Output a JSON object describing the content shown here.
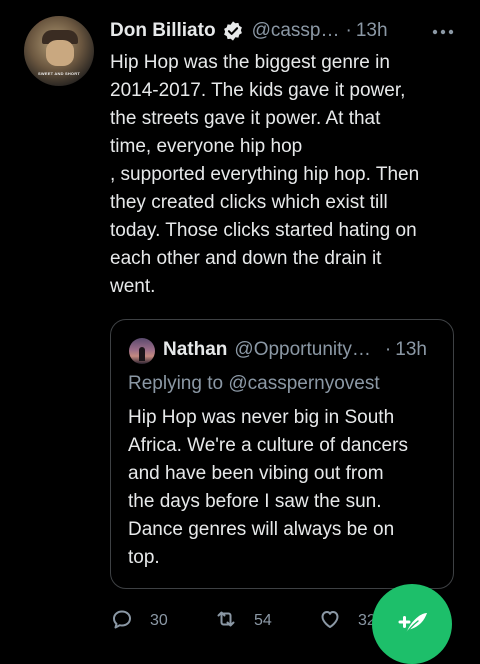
{
  "tweet": {
    "author_name": "Don Billiato",
    "handle": "@cassp…",
    "dot": "·",
    "time": "13h",
    "body_lines": [
      "Hip Hop was the biggest genre in",
      "2014-2017. The kids gave it power,",
      "the streets gave it power. At that",
      "time, everyone hip hop",
      ", supported everything hip hop. Then",
      "they created clicks which exist till",
      "today. Those clicks started hating on",
      "each other and down the drain it",
      "went."
    ],
    "avatar_text": "SWEET AND SHORT",
    "icons": {
      "verified": "verified-badge-icon",
      "more": "more-options-icon"
    }
  },
  "quote": {
    "author_name": "Nathan",
    "handle": "@Opportunity…",
    "dot": "·",
    "time": "13h",
    "replying_prefix": "Replying to",
    "replying_handle": "@casspernyovest",
    "body_lines": [
      "Hip Hop was never big in South",
      "Africa. We're a culture of dancers",
      "and have been vibing out from",
      "the days before I saw the sun.",
      "Dance genres will always be on",
      "top."
    ]
  },
  "actions": {
    "reply_count": "30",
    "retweet_count": "54",
    "like_count": "32"
  },
  "colors": {
    "background": "#000000",
    "text": "#e7e9ea",
    "muted": "#8b98a5",
    "fab": "#1dbf6a"
  }
}
